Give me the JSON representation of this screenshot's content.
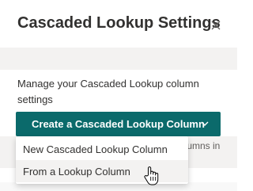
{
  "header": {
    "title": "Cascaded Lookup Settings",
    "close_icon": "close-icon"
  },
  "main": {
    "description": "Manage your Cascaded Lookup column settings",
    "create_button": {
      "label": "Create a Cascaded Lookup Column",
      "icon": "chevron-down-icon"
    },
    "partially_hidden_text": "olumns in"
  },
  "dropdown": {
    "items": [
      {
        "label": "New Cascaded Lookup Column"
      },
      {
        "label": "From a Lookup Column"
      }
    ]
  },
  "colors": {
    "accent": "#0b6a6b",
    "text": "#323130",
    "band": "#f3f2f1"
  },
  "cursor_icon": "hand-pointer-icon"
}
